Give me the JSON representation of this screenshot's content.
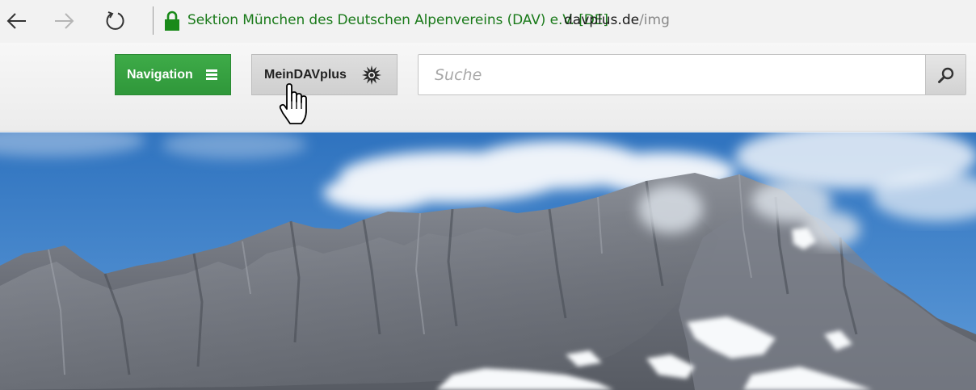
{
  "browser": {
    "site_identity": "Sektion München des Deutschen Alpenvereins (DAV) e.V. [DE]",
    "url_domain": "davplus.de",
    "url_path": "/img",
    "icons": [
      "back-arrow-icon",
      "forward-arrow-icon",
      "refresh-icon",
      "lock-icon"
    ]
  },
  "header": {
    "navigation_label": "Navigation",
    "meindav_label": "MeinDAVplus",
    "search": {
      "placeholder": "Suche",
      "value": ""
    },
    "icons": [
      "hamburger-menu-icon",
      "edelweiss-icon",
      "search-icon",
      "hand-pointer-cursor"
    ]
  },
  "colors": {
    "site_identity_green": "#1a7a1a",
    "navigation_button_green": "#38a243",
    "sky_blue": "#3a7fc8"
  },
  "hero": {
    "subject": "mountain-photo"
  }
}
